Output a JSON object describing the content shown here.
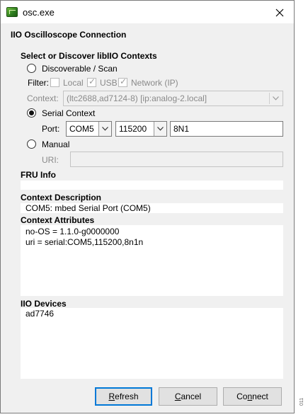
{
  "window": {
    "title": "osc.exe"
  },
  "dialog": {
    "heading": "IIO Oscilloscope Connection",
    "select_heading": "Select or Discover libIIO Contexts",
    "discoverable": {
      "label": "Discoverable / Scan",
      "selected": false
    },
    "filter": {
      "label": "Filter:",
      "options": [
        {
          "label": "Local",
          "checked": false
        },
        {
          "label": "USB",
          "checked": true
        },
        {
          "label": "Network (IP)",
          "checked": true
        }
      ]
    },
    "context": {
      "label": "Context:",
      "value": "(ltc2688,ad7124-8) [ip:analog-2.local]"
    },
    "serial": {
      "label": "Serial Context",
      "selected": true
    },
    "port": {
      "label": "Port:",
      "port_value": "COM5",
      "baud_value": "115200",
      "settings_value": "8N1"
    },
    "manual": {
      "label": "Manual",
      "selected": false
    },
    "uri": {
      "label": "URI:",
      "value": ""
    },
    "fru_info": {
      "heading": "FRU Info",
      "value": ""
    },
    "context_description": {
      "heading": "Context Description",
      "value": "COM5: mbed Serial Port (COM5)"
    },
    "context_attributes": {
      "heading": "Context Attributes",
      "lines": [
        "no-OS = 1.1.0-g0000000",
        "uri = serial:COM5,115200,8n1n"
      ]
    },
    "iio_devices": {
      "heading": "IIO Devices",
      "items": [
        "ad7746"
      ]
    },
    "buttons": {
      "refresh": {
        "mnemonic": "R",
        "rest": "efresh"
      },
      "cancel": {
        "mnemonic": "C",
        "rest": "ancel"
      },
      "connect": {
        "pre": "Co",
        "mnemonic": "n",
        "rest": "nect"
      }
    }
  },
  "figure_number": "011"
}
